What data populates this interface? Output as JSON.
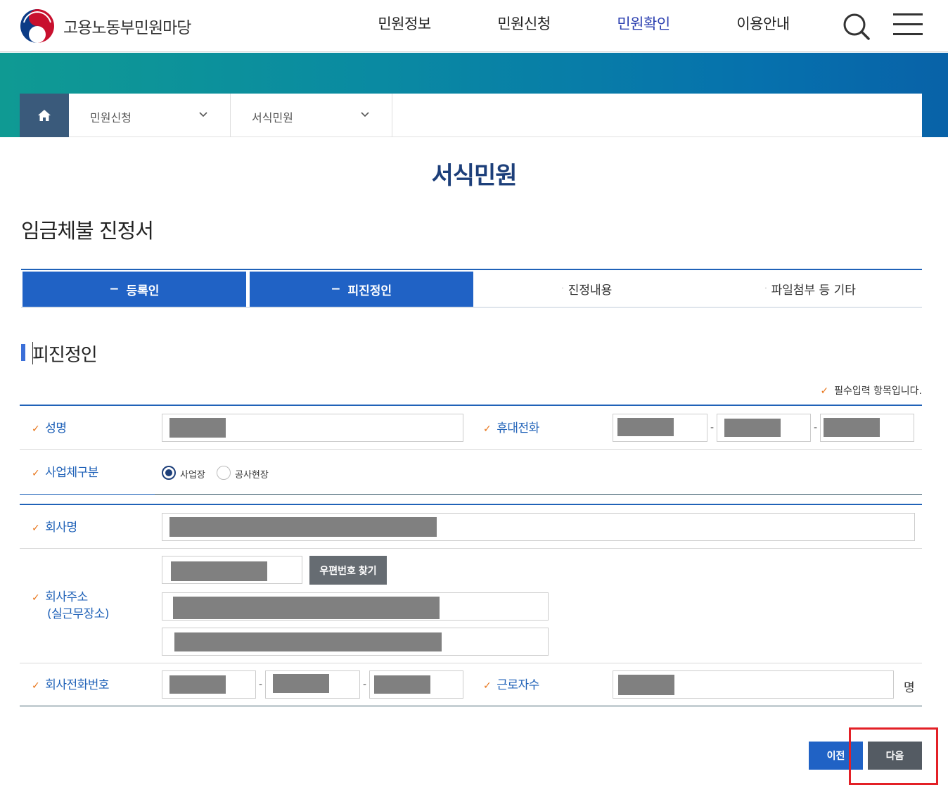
{
  "header": {
    "site_name": "고용노동부민원마당",
    "nav": [
      {
        "label": "민원정보",
        "active": false
      },
      {
        "label": "민원신청",
        "active": false
      },
      {
        "label": "민원확인",
        "active": true
      },
      {
        "label": "이용안내",
        "active": false
      }
    ]
  },
  "breadcrumb": {
    "level1": "민원신청",
    "level2": "서식민원"
  },
  "page_title": "서식민원",
  "doc_title": "임금체불 진정서",
  "steps": [
    {
      "label": "등록인",
      "active": true
    },
    {
      "label": "피진정인",
      "active": true
    },
    {
      "label": "진정내용",
      "active": false
    },
    {
      "label": "파일첨부 등 기타",
      "active": false
    }
  ],
  "section_title": "피진정인",
  "required_note": "필수입력 항목입니다.",
  "form": {
    "name_label": "성명",
    "mobile_label": "휴대전화",
    "biz_type_label": "사업체구분",
    "biz_type_options": [
      "사업장",
      "공사현장"
    ],
    "biz_type_selected": "사업장",
    "company_label": "회사명",
    "address_label_line1": "회사주소",
    "address_label_line2": "(실근무장소)",
    "zip_button": "우편번호 찾기",
    "phone_label": "회사전화번호",
    "workers_label": "근로자수",
    "workers_unit": "명",
    "dash": "-"
  },
  "buttons": {
    "prev": "이전",
    "next": "다음"
  },
  "colors": {
    "primary": "#2062c5",
    "navy": "#1d3f7a",
    "check": "#e8751a",
    "highlight": "#e32026"
  }
}
